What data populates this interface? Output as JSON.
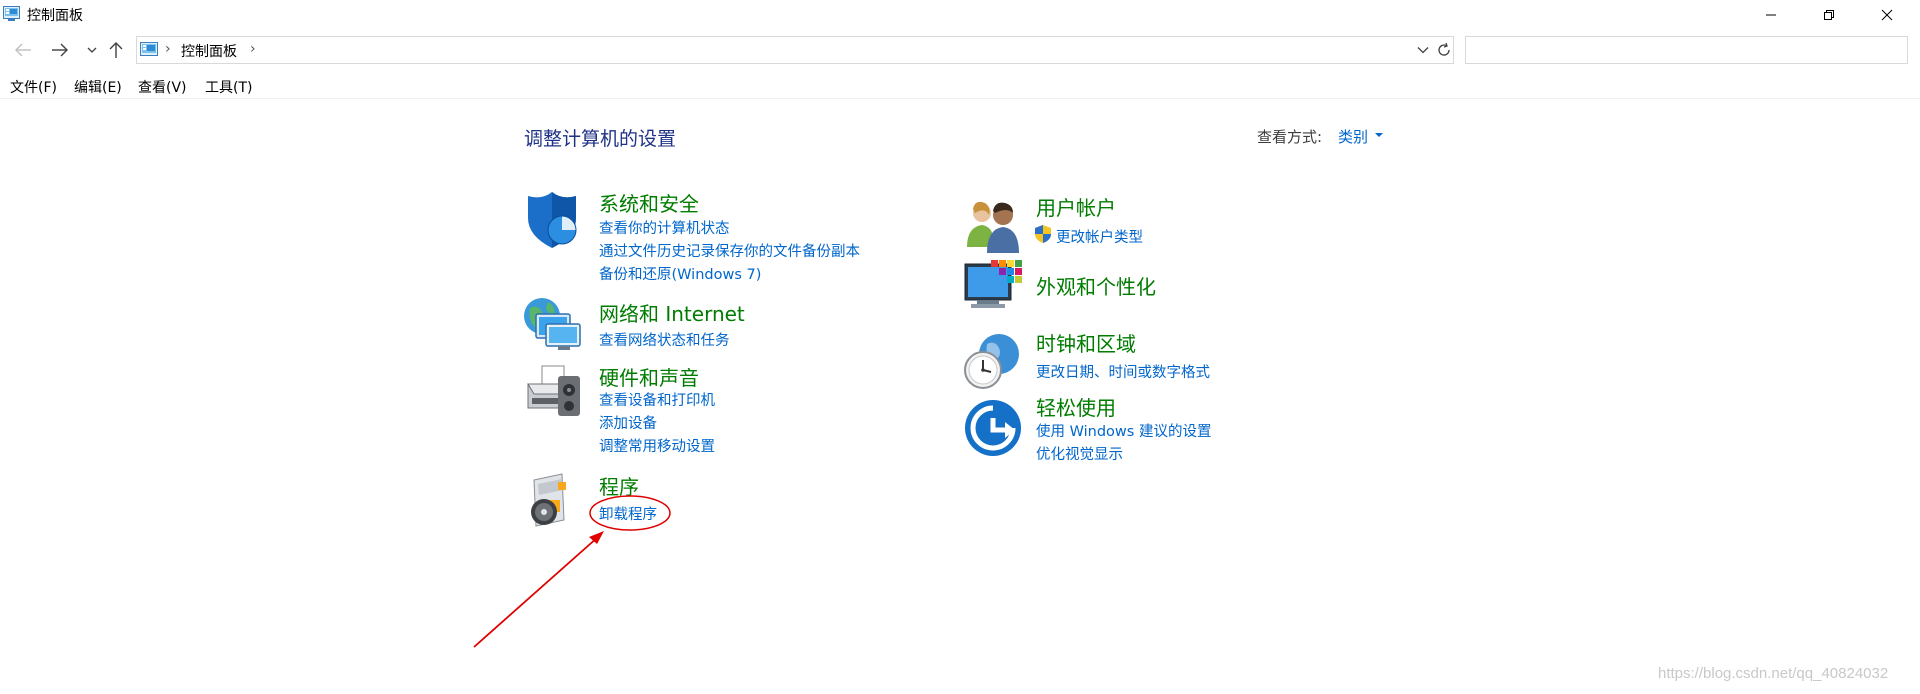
{
  "window": {
    "title": "控制面板",
    "controls": {
      "minimize": "minimize",
      "maximize": "restore",
      "close": "close"
    }
  },
  "address": {
    "crumbs": [
      "控制面板"
    ],
    "search_value": ""
  },
  "menu": {
    "items": [
      "文件(F)",
      "编辑(E)",
      "查看(V)",
      "工具(T)"
    ]
  },
  "content": {
    "title": "调整计算机的设置",
    "view_by_label": "查看方式:",
    "view_by_value": "类别",
    "categories": [
      {
        "title": "系统和安全",
        "icon": "shield-icon",
        "links": [
          "查看你的计算机状态",
          "通过文件历史记录保存你的文件备份副本",
          "备份和还原(Windows 7)"
        ]
      },
      {
        "title": "网络和 Internet",
        "icon": "network-icon",
        "links": [
          "查看网络状态和任务"
        ]
      },
      {
        "title": "硬件和声音",
        "icon": "printer-icon",
        "links": [
          "查看设备和打印机",
          "添加设备",
          "调整常用移动设置"
        ]
      },
      {
        "title": "程序",
        "icon": "programs-icon",
        "links": [
          "卸载程序"
        ]
      },
      {
        "title": "用户帐户",
        "icon": "users-icon",
        "links": [
          "更改帐户类型"
        ]
      },
      {
        "title": "外观和个性化",
        "icon": "personalization-icon",
        "links": []
      },
      {
        "title": "时钟和区域",
        "icon": "clock-icon",
        "links": [
          "更改日期、时间或数字格式"
        ]
      },
      {
        "title": "轻松使用",
        "icon": "ease-of-access-icon",
        "links": [
          "使用 Windows 建议的设置",
          "优化视觉显示"
        ]
      }
    ]
  },
  "watermark": "https://blog.csdn.net/qq_40824032",
  "colors": {
    "category_title": "#007c00",
    "link": "#0066cc",
    "page_title": "#1e3287",
    "annotation": "#e00000"
  }
}
